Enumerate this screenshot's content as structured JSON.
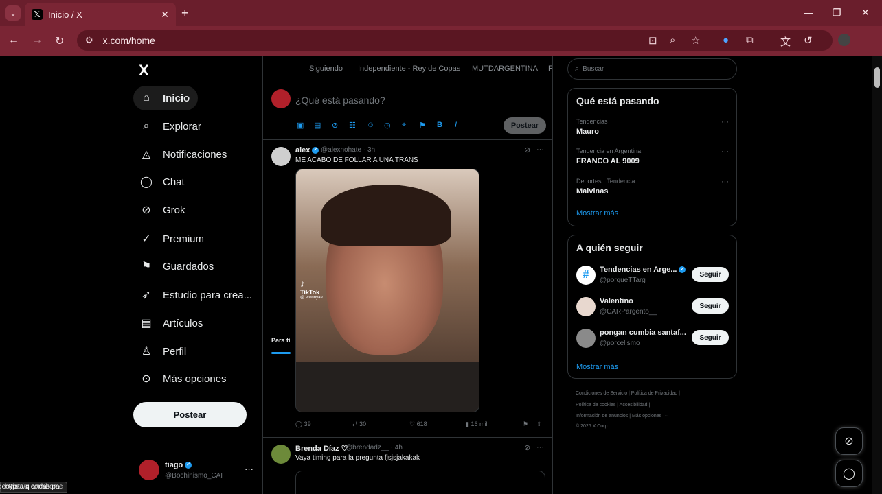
{
  "browser": {
    "tab_title": "Inicio / X",
    "tab_icon": "x-logo-icon",
    "url": "x.com/home",
    "status_url": "https://x.com/home",
    "status_overlay": "Ideoyista q andas pa",
    "accent": "#7a2534"
  },
  "sidebar": {
    "logo": "X",
    "items": [
      {
        "label": "Inicio",
        "icon": "home-icon"
      },
      {
        "label": "Explorar",
        "icon": "search-icon"
      },
      {
        "label": "Notificaciones",
        "icon": "bell-icon"
      },
      {
        "label": "Chat",
        "icon": "chat-icon"
      },
      {
        "label": "Grok",
        "icon": "grok-icon"
      },
      {
        "label": "Premium",
        "icon": "premium-icon"
      },
      {
        "label": "Guardados",
        "icon": "bookmark-icon"
      },
      {
        "label": "Estudio para crea...",
        "icon": "rocket-icon"
      },
      {
        "label": "Artículos",
        "icon": "article-icon"
      },
      {
        "label": "Perfil",
        "icon": "person-icon"
      },
      {
        "label": "Más opciones",
        "icon": "more-circle-icon"
      }
    ],
    "post_button": "Postear",
    "user": {
      "name": "tiago",
      "handle": "@Bochinismo_CAI"
    }
  },
  "feed": {
    "tabs": [
      "Para ti",
      "Siguiendo",
      "Independiente - Rey de Copas",
      "MUTDARGENTINA",
      "F"
    ],
    "compose_placeholder": "¿Qué está pasando?",
    "compose_button": "Postear",
    "posts": [
      {
        "name": "alex",
        "handle": "@alexnohate · 3h",
        "text": "ME ACABO DE FOLLAR A UNA TRANS",
        "media_watermark": "TikTok",
        "media_watermark_user": "@ eronnyae",
        "replies": "39",
        "reposts": "30",
        "likes": "618",
        "views": "16 mil"
      },
      {
        "name": "Brenda Díaz ♡",
        "handle": "@brendadz__ · 4h",
        "text": "Vaya timing para la pregunta fjsjsjakakak"
      }
    ]
  },
  "right": {
    "search_placeholder": "Buscar",
    "trending_title": "Qué está pasando",
    "trends": [
      {
        "context": "Tendencias",
        "name": "Mauro"
      },
      {
        "context": "Tendencia en Argentina",
        "name": "FRANCO AL 9009"
      },
      {
        "context": "Deportes · Tendencia",
        "name": "Malvinas"
      }
    ],
    "show_more": "Mostrar más",
    "who_title": "A quién seguir",
    "who": [
      {
        "name": "Tendencias en Arge...",
        "handle": "@porqueTTarg",
        "button": "Seguir"
      },
      {
        "name": "Valentino",
        "handle": "@CARPargento__",
        "button": "Seguir"
      },
      {
        "name": "pongan cumbia santaf...",
        "handle": "@porcelismo",
        "button": "Seguir"
      }
    ],
    "footer": [
      "Condiciones de Servicio  |  Política de Privacidad  |",
      "Política de cookies  |  Accesibilidad  |",
      "Información de anuncios  |  Más opciones ···",
      "© 2026 X Corp."
    ]
  }
}
